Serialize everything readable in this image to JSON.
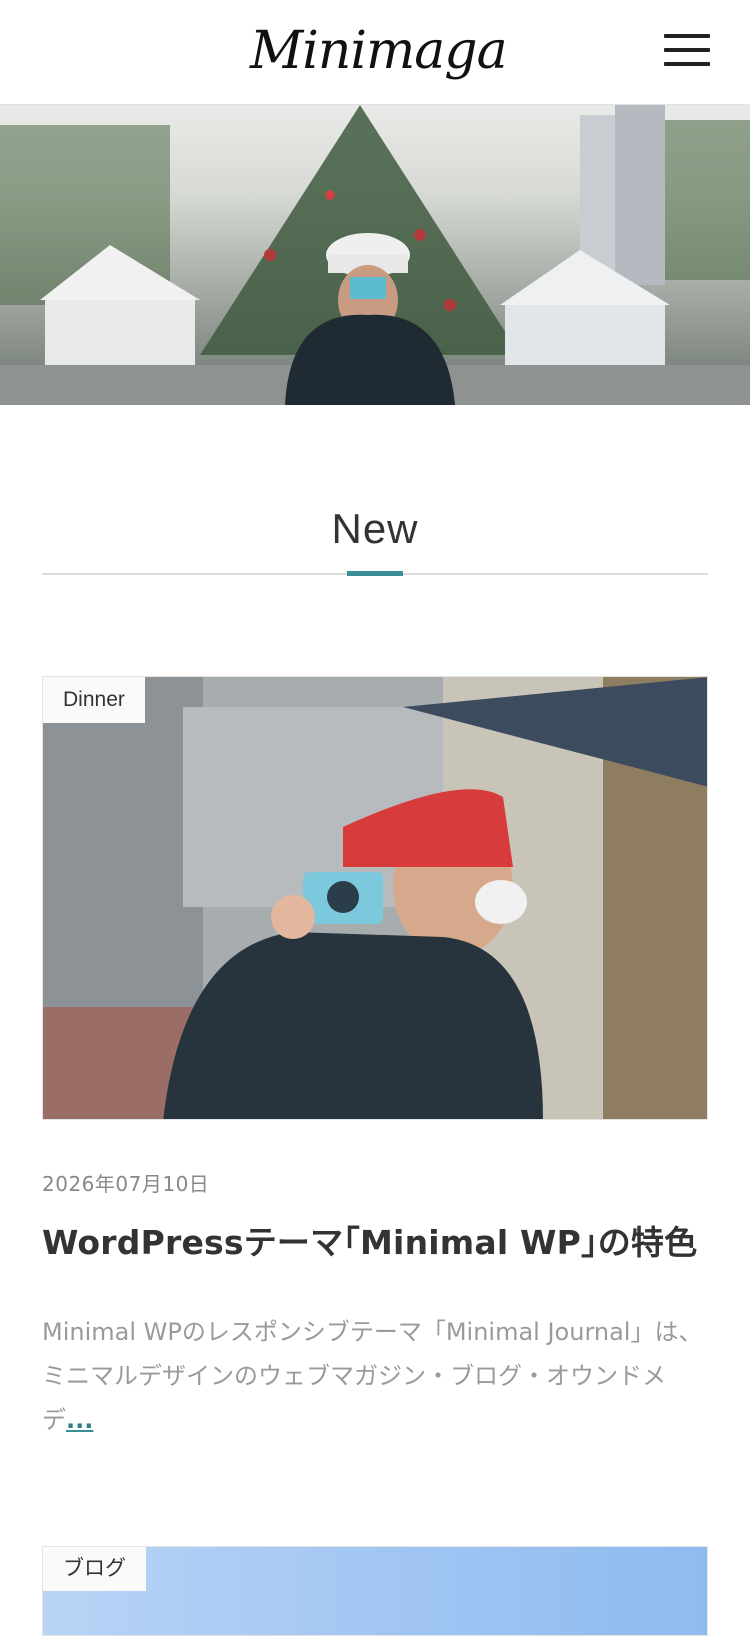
{
  "header": {
    "logo_text": "Minimaga",
    "menu_icon": "hamburger-icon"
  },
  "section": {
    "title": "New",
    "accent_color": "#3a8e96"
  },
  "posts": [
    {
      "category": "Dinner",
      "date": "2026年07月10日",
      "title": "WordPressテーマ｢Minimal WP｣の特色",
      "excerpt": "Minimal WPのレスポンシブテーマ「Minimal Journal」は、 ミニマルデザインのウェブマガジン・ブログ・オウンドメデ",
      "more": "..."
    },
    {
      "category": "ブログ"
    }
  ]
}
